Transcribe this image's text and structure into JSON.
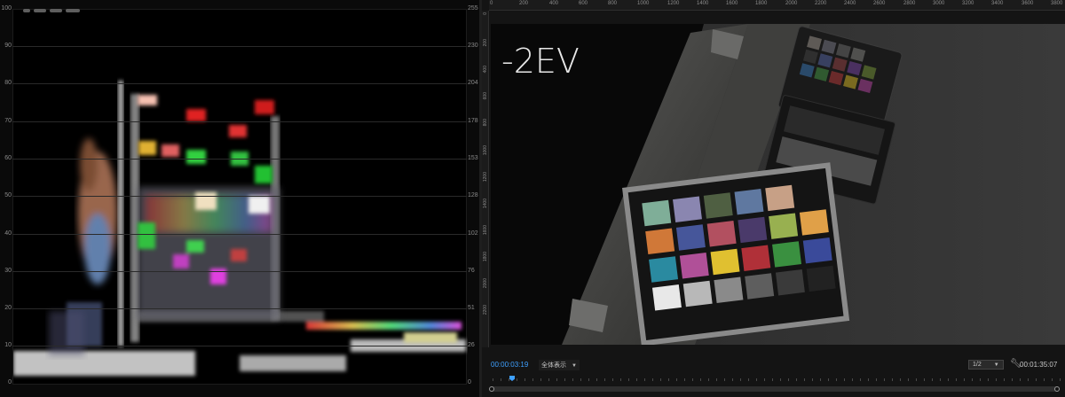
{
  "scope": {
    "left_ticks": [
      "100",
      "90",
      "80",
      "70",
      "60",
      "50",
      "40",
      "30",
      "20",
      "10",
      "0"
    ],
    "right_ticks": [
      "255",
      "230",
      "204",
      "178",
      "153",
      "128",
      "102",
      "76",
      "51",
      "26",
      "0"
    ]
  },
  "monitor": {
    "ruler_top_labels": [
      "0",
      "200",
      "400",
      "600",
      "800",
      "1000",
      "1200",
      "1400",
      "1600",
      "1800",
      "2000",
      "2200",
      "2400",
      "2600",
      "2800",
      "3000",
      "3200",
      "3400",
      "3600",
      "3800"
    ],
    "ruler_left_labels": [
      "0",
      "200",
      "400",
      "600",
      "800",
      "1000",
      "1200",
      "1400",
      "1600",
      "1800",
      "2000",
      "2200"
    ],
    "overlay_text": "-2EV",
    "current_timecode": "00:00:03:19",
    "fit_label": "全体表示",
    "resolution_label": "1/2",
    "duration_timecode": "00:01:35:07"
  },
  "colors": {
    "accent": "#3ea0ff",
    "panel_bg": "#141414",
    "scope_bg": "#000000"
  },
  "icons": [
    "chevron-down-icon",
    "wrench-icon",
    "playhead-icon"
  ]
}
